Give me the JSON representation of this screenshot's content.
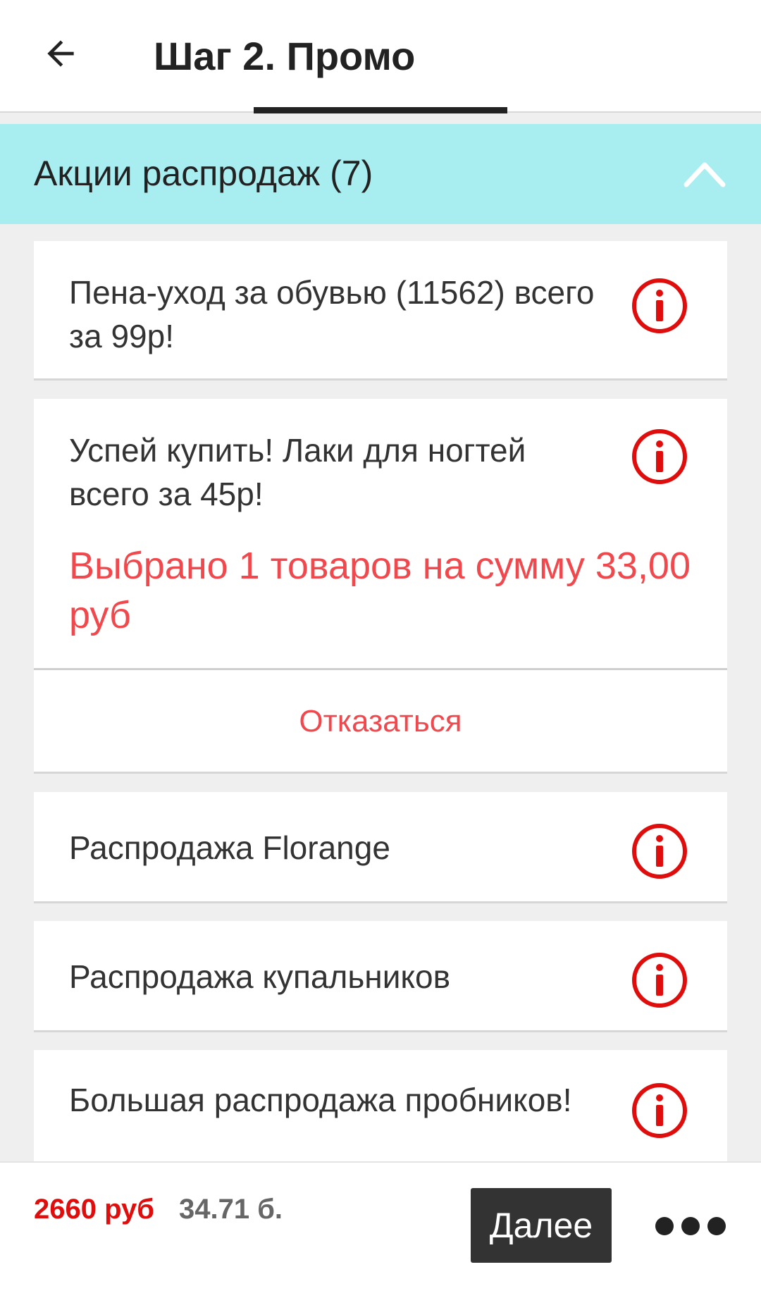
{
  "header": {
    "title": "Шаг 2. Промо",
    "back_icon": "arrow-left-icon"
  },
  "section": {
    "title": "Акции распродаж (7)",
    "collapse_icon": "chevron-up-icon"
  },
  "promos": [
    {
      "text": "Пена-уход за обувью (11562) всего за 99р!",
      "icon": "info-icon"
    },
    {
      "text": "Успей купить! Лаки для ногтей всего за 45р!",
      "icon": "info-icon",
      "selected_text": "Выбрано 1 товаров на сумму 33,00 руб",
      "decline_label": "Отказаться"
    },
    {
      "text": "Распродажа Florange",
      "icon": "info-icon"
    },
    {
      "text": "Распродажа купальников",
      "icon": "info-icon"
    },
    {
      "text": "Большая распродажа пробников!",
      "icon": "info-icon"
    }
  ],
  "footer": {
    "price": "2660 руб",
    "points": "34.71 б.",
    "next_label": "Далее",
    "more_icon": "more-horizontal-icon"
  },
  "colors": {
    "accent_red": "#f0484c",
    "icon_red": "#e00d0d",
    "section_bg": "#a8eef1",
    "button_dark": "#333333"
  }
}
